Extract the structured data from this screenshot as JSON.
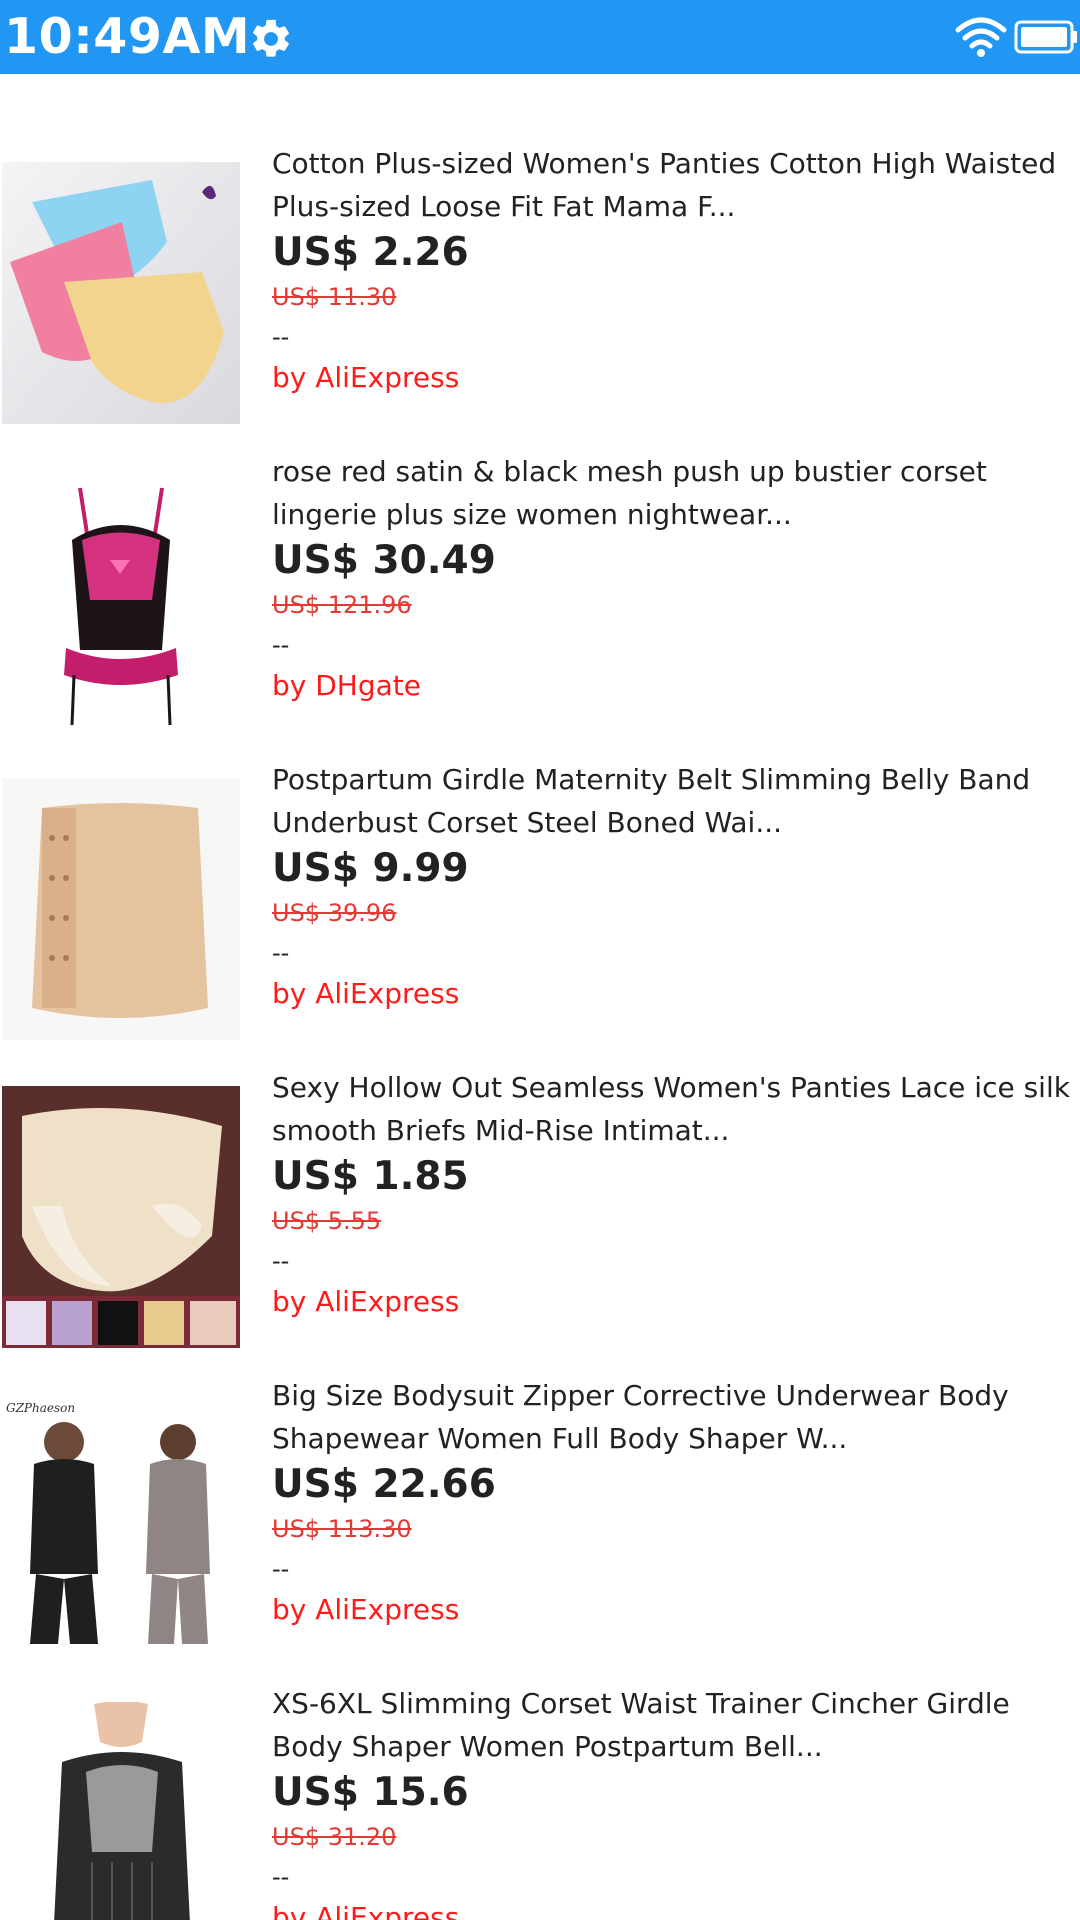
{
  "status_bar": {
    "time": "10:49AM",
    "background_color": "#2196F3",
    "icons": [
      "gear-icon",
      "wifi-icon",
      "battery-icon"
    ]
  },
  "colors": {
    "price": "#222222",
    "old_price": "#e53935",
    "seller": "#ff1a1a"
  },
  "products": [
    {
      "title": "Cotton Plus-sized Women's Panties Cotton High Waisted Plus-sized Loose Fit Fat Mama F...",
      "price": "US$ 2.26",
      "old_price": "US$ 11.30",
      "rating": "--",
      "seller": "by AliExpress",
      "image": "pastel-panties-photo"
    },
    {
      "title": "rose red satin & black mesh push up bustier corset lingerie plus size women nightwear...",
      "price": "US$ 30.49",
      "old_price": "US$ 121.96",
      "rating": "--",
      "seller": "by DHgate",
      "image": "pink-black-corset-photo"
    },
    {
      "title": "Postpartum Girdle Maternity Belt Slimming Belly Band Underbust Corset Steel Boned Wai...",
      "price": "US$ 9.99",
      "old_price": "US$ 39.96",
      "rating": "--",
      "seller": "by AliExpress",
      "image": "beige-girdle-photo"
    },
    {
      "title": "Sexy Hollow Out Seamless Women's Panties Lace ice silk smooth Briefs Mid-Rise Intimat...",
      "price": "US$ 1.85",
      "old_price": "US$ 5.55",
      "rating": "--",
      "seller": "by AliExpress",
      "image": "lace-panties-photo"
    },
    {
      "title": "Big Size Bodysuit Zipper Corrective Underwear Body Shapewear Women Full Body Shaper W...",
      "price": "US$ 22.66",
      "old_price": "US$ 113.30",
      "rating": "--",
      "seller": "by AliExpress",
      "image": "bodysuit-models-photo",
      "image_caption": "GZPhaeson"
    },
    {
      "title": "XS-6XL Slimming Corset Waist Trainer Cincher Girdle Body Shaper Women Postpartum Bell...",
      "price": "US$ 15.6",
      "old_price": "US$ 31.20",
      "rating": "--",
      "seller": "by AliExpress",
      "image": "waist-trainer-model-photo"
    }
  ]
}
